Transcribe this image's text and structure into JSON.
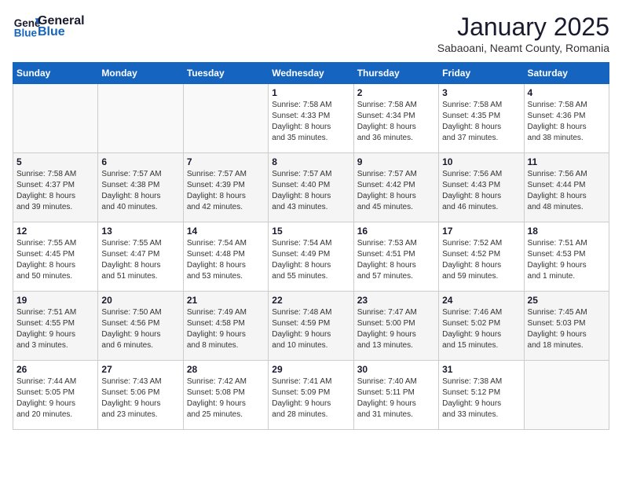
{
  "header": {
    "logo_general": "General",
    "logo_blue": "Blue",
    "month": "January 2025",
    "location": "Sabaoani, Neamt County, Romania"
  },
  "weekdays": [
    "Sunday",
    "Monday",
    "Tuesday",
    "Wednesday",
    "Thursday",
    "Friday",
    "Saturday"
  ],
  "weeks": [
    [
      {
        "day": "",
        "info": ""
      },
      {
        "day": "",
        "info": ""
      },
      {
        "day": "",
        "info": ""
      },
      {
        "day": "1",
        "info": "Sunrise: 7:58 AM\nSunset: 4:33 PM\nDaylight: 8 hours\nand 35 minutes."
      },
      {
        "day": "2",
        "info": "Sunrise: 7:58 AM\nSunset: 4:34 PM\nDaylight: 8 hours\nand 36 minutes."
      },
      {
        "day": "3",
        "info": "Sunrise: 7:58 AM\nSunset: 4:35 PM\nDaylight: 8 hours\nand 37 minutes."
      },
      {
        "day": "4",
        "info": "Sunrise: 7:58 AM\nSunset: 4:36 PM\nDaylight: 8 hours\nand 38 minutes."
      }
    ],
    [
      {
        "day": "5",
        "info": "Sunrise: 7:58 AM\nSunset: 4:37 PM\nDaylight: 8 hours\nand 39 minutes."
      },
      {
        "day": "6",
        "info": "Sunrise: 7:57 AM\nSunset: 4:38 PM\nDaylight: 8 hours\nand 40 minutes."
      },
      {
        "day": "7",
        "info": "Sunrise: 7:57 AM\nSunset: 4:39 PM\nDaylight: 8 hours\nand 42 minutes."
      },
      {
        "day": "8",
        "info": "Sunrise: 7:57 AM\nSunset: 4:40 PM\nDaylight: 8 hours\nand 43 minutes."
      },
      {
        "day": "9",
        "info": "Sunrise: 7:57 AM\nSunset: 4:42 PM\nDaylight: 8 hours\nand 45 minutes."
      },
      {
        "day": "10",
        "info": "Sunrise: 7:56 AM\nSunset: 4:43 PM\nDaylight: 8 hours\nand 46 minutes."
      },
      {
        "day": "11",
        "info": "Sunrise: 7:56 AM\nSunset: 4:44 PM\nDaylight: 8 hours\nand 48 minutes."
      }
    ],
    [
      {
        "day": "12",
        "info": "Sunrise: 7:55 AM\nSunset: 4:45 PM\nDaylight: 8 hours\nand 50 minutes."
      },
      {
        "day": "13",
        "info": "Sunrise: 7:55 AM\nSunset: 4:47 PM\nDaylight: 8 hours\nand 51 minutes."
      },
      {
        "day": "14",
        "info": "Sunrise: 7:54 AM\nSunset: 4:48 PM\nDaylight: 8 hours\nand 53 minutes."
      },
      {
        "day": "15",
        "info": "Sunrise: 7:54 AM\nSunset: 4:49 PM\nDaylight: 8 hours\nand 55 minutes."
      },
      {
        "day": "16",
        "info": "Sunrise: 7:53 AM\nSunset: 4:51 PM\nDaylight: 8 hours\nand 57 minutes."
      },
      {
        "day": "17",
        "info": "Sunrise: 7:52 AM\nSunset: 4:52 PM\nDaylight: 8 hours\nand 59 minutes."
      },
      {
        "day": "18",
        "info": "Sunrise: 7:51 AM\nSunset: 4:53 PM\nDaylight: 9 hours\nand 1 minute."
      }
    ],
    [
      {
        "day": "19",
        "info": "Sunrise: 7:51 AM\nSunset: 4:55 PM\nDaylight: 9 hours\nand 3 minutes."
      },
      {
        "day": "20",
        "info": "Sunrise: 7:50 AM\nSunset: 4:56 PM\nDaylight: 9 hours\nand 6 minutes."
      },
      {
        "day": "21",
        "info": "Sunrise: 7:49 AM\nSunset: 4:58 PM\nDaylight: 9 hours\nand 8 minutes."
      },
      {
        "day": "22",
        "info": "Sunrise: 7:48 AM\nSunset: 4:59 PM\nDaylight: 9 hours\nand 10 minutes."
      },
      {
        "day": "23",
        "info": "Sunrise: 7:47 AM\nSunset: 5:00 PM\nDaylight: 9 hours\nand 13 minutes."
      },
      {
        "day": "24",
        "info": "Sunrise: 7:46 AM\nSunset: 5:02 PM\nDaylight: 9 hours\nand 15 minutes."
      },
      {
        "day": "25",
        "info": "Sunrise: 7:45 AM\nSunset: 5:03 PM\nDaylight: 9 hours\nand 18 minutes."
      }
    ],
    [
      {
        "day": "26",
        "info": "Sunrise: 7:44 AM\nSunset: 5:05 PM\nDaylight: 9 hours\nand 20 minutes."
      },
      {
        "day": "27",
        "info": "Sunrise: 7:43 AM\nSunset: 5:06 PM\nDaylight: 9 hours\nand 23 minutes."
      },
      {
        "day": "28",
        "info": "Sunrise: 7:42 AM\nSunset: 5:08 PM\nDaylight: 9 hours\nand 25 minutes."
      },
      {
        "day": "29",
        "info": "Sunrise: 7:41 AM\nSunset: 5:09 PM\nDaylight: 9 hours\nand 28 minutes."
      },
      {
        "day": "30",
        "info": "Sunrise: 7:40 AM\nSunset: 5:11 PM\nDaylight: 9 hours\nand 31 minutes."
      },
      {
        "day": "31",
        "info": "Sunrise: 7:38 AM\nSunset: 5:12 PM\nDaylight: 9 hours\nand 33 minutes."
      },
      {
        "day": "",
        "info": ""
      }
    ]
  ]
}
